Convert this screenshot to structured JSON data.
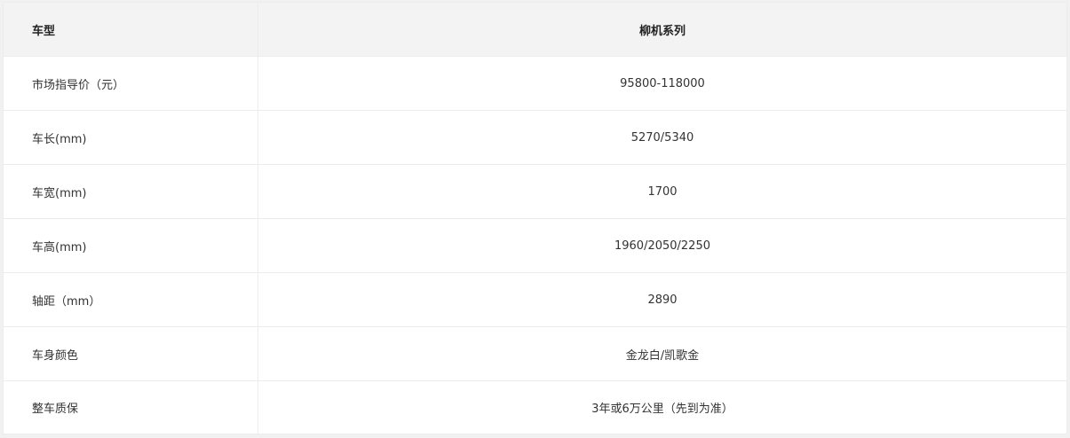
{
  "table": {
    "header": {
      "label": "车型",
      "value": "柳机系列"
    },
    "rows": [
      {
        "label": "市场指导价（元）",
        "value": "95800-118000"
      },
      {
        "label": "车长(mm)",
        "value": "5270/5340"
      },
      {
        "label": "车宽(mm)",
        "value": "1700"
      },
      {
        "label": "车高(mm)",
        "value": "1960/2050/2250"
      },
      {
        "label": "轴距（mm）",
        "value": "2890"
      },
      {
        "label": "车身颜色",
        "value": "金龙白/凯歌金"
      },
      {
        "label": "整车质保",
        "value": "3年或6万公里（先到为准）"
      }
    ]
  }
}
